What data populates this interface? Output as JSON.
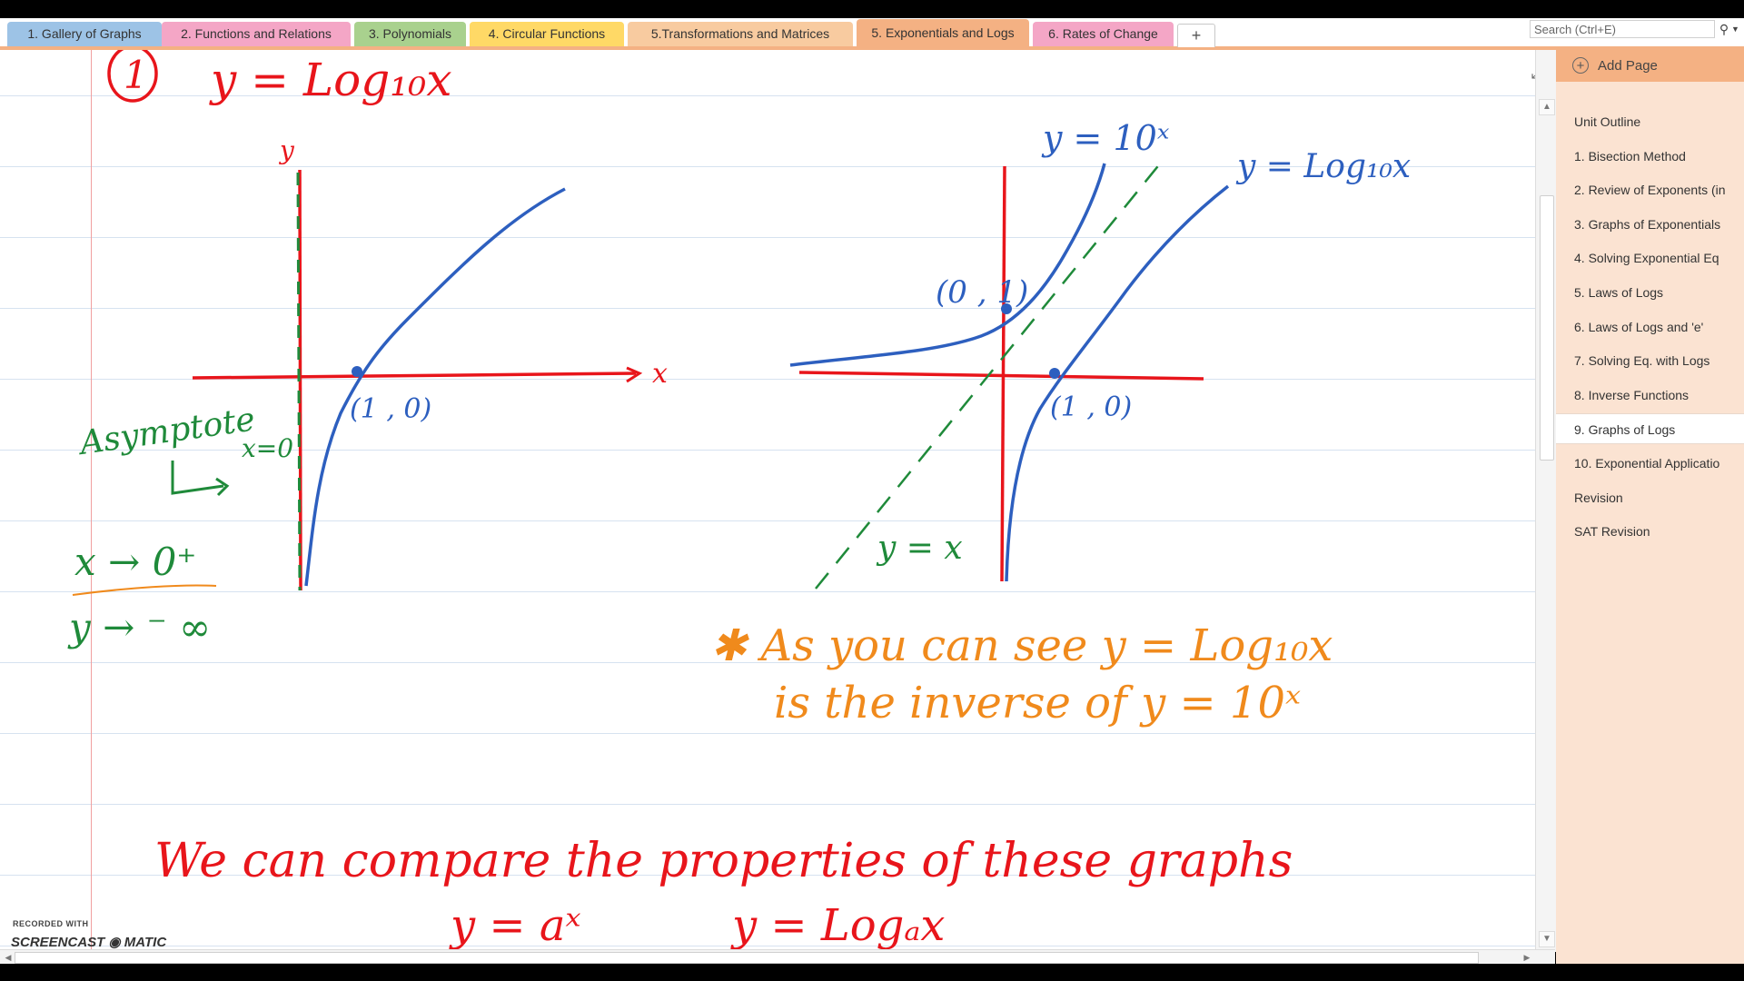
{
  "section_tabs": [
    {
      "label": "1. Gallery of Graphs",
      "color": "#9dc3e6",
      "active": false
    },
    {
      "label": "2. Functions and Relations",
      "color": "#f4a6c6",
      "active": false
    },
    {
      "label": "3. Polynomials",
      "color": "#a9d18e",
      "active": false
    },
    {
      "label": "4. Circular Functions",
      "color": "#ffd966",
      "active": false
    },
    {
      "label": "5.Transformations and Matrices",
      "color": "#f8cba0",
      "active": false
    },
    {
      "label": "5. Exponentials and Logs",
      "color": "#f4b183",
      "active": true
    },
    {
      "label": "6. Rates of Change",
      "color": "#f4a6c6",
      "active": false
    }
  ],
  "add_tab_label": "+",
  "search": {
    "placeholder": "Search (Ctrl+E)",
    "icon": "magnifier-icon"
  },
  "pages_panel": {
    "add_page_label": "Add Page",
    "pages": [
      {
        "label": "Unit Outline",
        "selected": false
      },
      {
        "label": "1. Bisection Method",
        "selected": false
      },
      {
        "label": "2. Review of Exponents (in",
        "selected": false
      },
      {
        "label": "3. Graphs of Exponentials",
        "selected": false
      },
      {
        "label": "4. Solving Exponential Eq",
        "selected": false
      },
      {
        "label": "5. Laws of Logs",
        "selected": false
      },
      {
        "label": "6. Laws of Logs and 'e'",
        "selected": false
      },
      {
        "label": "7. Solving Eq. with Logs",
        "selected": false
      },
      {
        "label": "8. Inverse Functions",
        "selected": false
      },
      {
        "label": "9. Graphs of Logs",
        "selected": true
      },
      {
        "label": "10. Exponential Applicatio",
        "selected": false
      },
      {
        "label": "Revision",
        "selected": false
      },
      {
        "label": "SAT Revision",
        "selected": false
      }
    ]
  },
  "notes": {
    "circled_number": "1",
    "title_eq": "y = Log₁₀x",
    "left_graph": {
      "y_axis": "y",
      "x_axis": "x",
      "point_label": "(1 , 0)",
      "asymptote_label": "Asymptote",
      "asymptote_eq": "x=0",
      "limit_x": "x → 0⁺",
      "limit_y": "y → ⁻ ∞"
    },
    "right_graph": {
      "exp_label": "y = 10ˣ",
      "log_label": "y = Log₁₀x",
      "exp_point": "(0 , 1)",
      "log_point": "(1 , 0)",
      "line_label": "y = x"
    },
    "remark_line1": "✱ As  you  can  see  y = Log₁₀x",
    "remark_line2": "is  the  inverse  of  y = 10ˣ",
    "compare_line": "We  can  compare  the  properties  of  these  graphs",
    "compare_eq1": "y = aˣ",
    "compare_eq2": "y = Logₐx"
  },
  "ink_colors": {
    "red": "#e8151b",
    "blue": "#2d5fbf",
    "green": "#1f8a3a",
    "orange": "#f08a1c"
  },
  "watermark": {
    "top": "RECORDED WITH",
    "bottom": "SCREENCAST ◉ MATIC"
  }
}
